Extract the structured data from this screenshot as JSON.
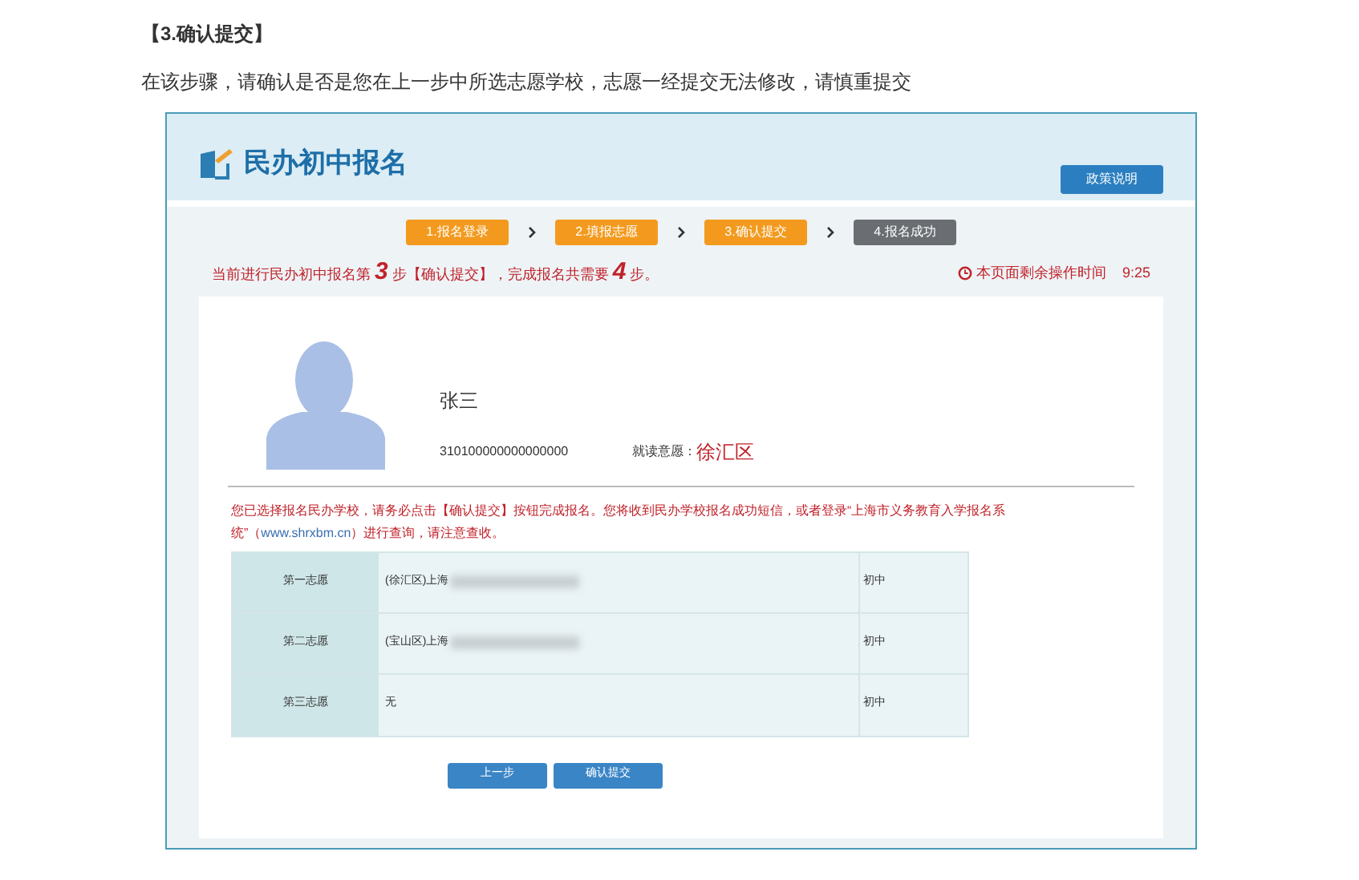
{
  "heading": "【3.确认提交】",
  "intro": "在该步骤，请确认是否是您在上一步中所选志愿学校，志愿一经提交无法修改，请慎重提交",
  "app": {
    "title": "民办初中报名",
    "policy_button": "政策说明",
    "steps": [
      {
        "label": "1.报名登录",
        "completed": true
      },
      {
        "label": "2.填报志愿",
        "completed": true
      },
      {
        "label": "3.确认提交",
        "completed": true
      },
      {
        "label": "4.报名成功",
        "completed": false
      }
    ],
    "progress_text": "当前进行民办初中报名第 **3** 步【确认提交】，完成报名共需要 **4** 步。",
    "timer_label": "本页面剩余操作时间",
    "timer_value": "9:25",
    "student": {
      "name": "张三",
      "id": "310100000000000000",
      "district_label": "就读意愿：",
      "district": "徐汇区"
    },
    "notice": "您已选择报名民办学校，请务必点击【确认提交】按钮完成报名。您将收到民办学校报名成功短信，或者登录“上海市义务教育入学报名系统”（",
    "notice_link": "www.shrxbm.cn",
    "notice_end": "）进行查询，请注意查收。",
    "choices": [
      {
        "rank": "第一志愿",
        "school": "(徐汇区)上海",
        "blurred": true,
        "level": "初中"
      },
      {
        "rank": "第二志愿",
        "school": "(宝山区)上海",
        "blurred": true,
        "level": "初中"
      },
      {
        "rank": "第三志愿",
        "school": "无",
        "blurred": false,
        "level": "初中"
      }
    ],
    "buttons": [
      "上一步",
      "确认提交"
    ]
  }
}
